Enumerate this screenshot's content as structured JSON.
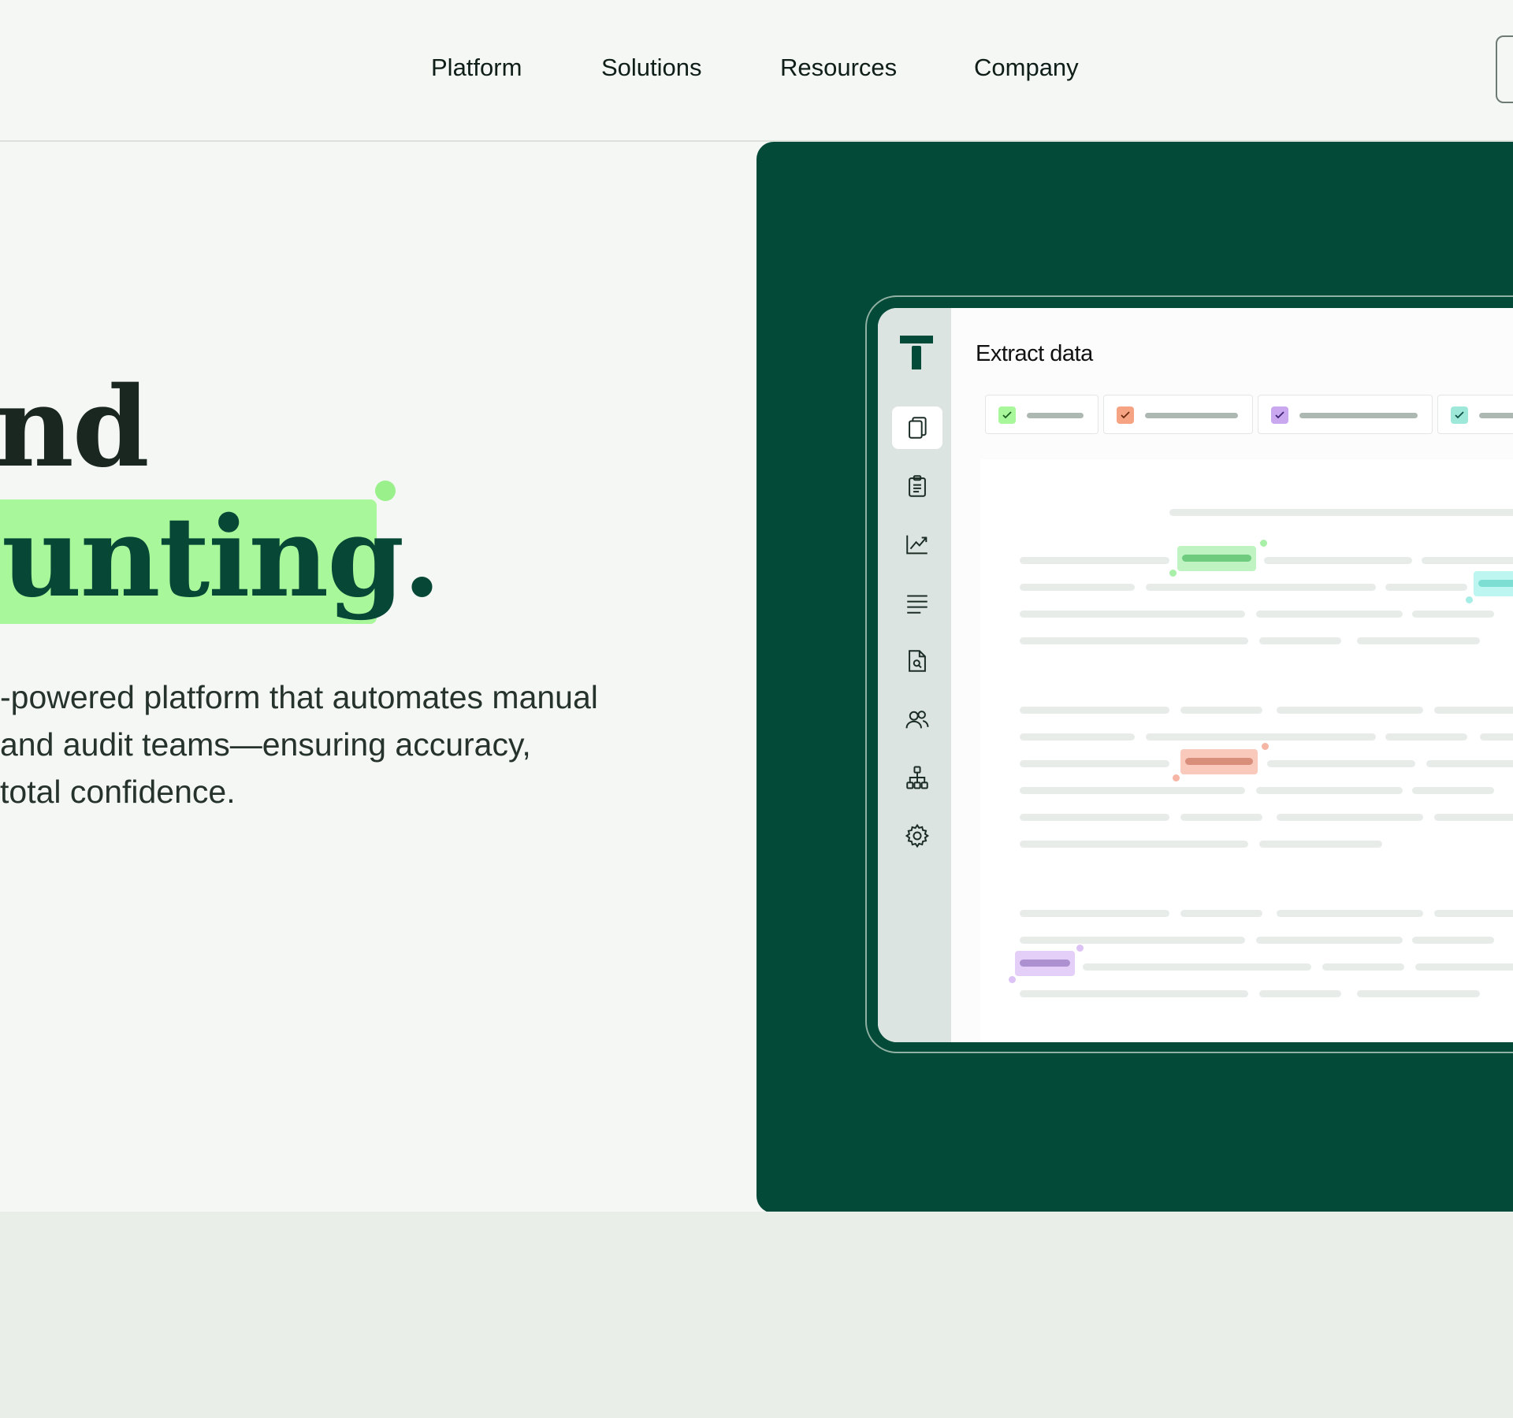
{
  "nav": {
    "items": [
      "Platform",
      "Solutions",
      "Resources",
      "Company"
    ]
  },
  "hero": {
    "headline_line1": "nd",
    "headline_line2": "unting.",
    "description": [
      "-powered platform that automates manual",
      " and audit teams—ensuring accuracy,",
      " total confidence."
    ]
  },
  "app": {
    "title": "Extract data",
    "sidebar_icons": [
      "documents-icon",
      "clipboard-icon",
      "chart-icon",
      "list-icon",
      "document-search-icon",
      "users-icon",
      "hierarchy-icon",
      "gear-icon"
    ],
    "active_icon": "documents-icon",
    "tags": [
      {
        "color": "#A8F79A",
        "check": "#1B5E20"
      },
      {
        "color": "#F5A383",
        "check": "#6A2A10"
      },
      {
        "color": "#C9A8F0",
        "check": "#3E2372"
      },
      {
        "color": "#9EE8DA",
        "check": "#0F4E44"
      }
    ]
  },
  "colors": {
    "panel": "#044A38",
    "highlight_green": "#A8F79A",
    "background": "#F4F7F3",
    "headline_dark": "#1A2720",
    "headline_green": "#064735"
  }
}
